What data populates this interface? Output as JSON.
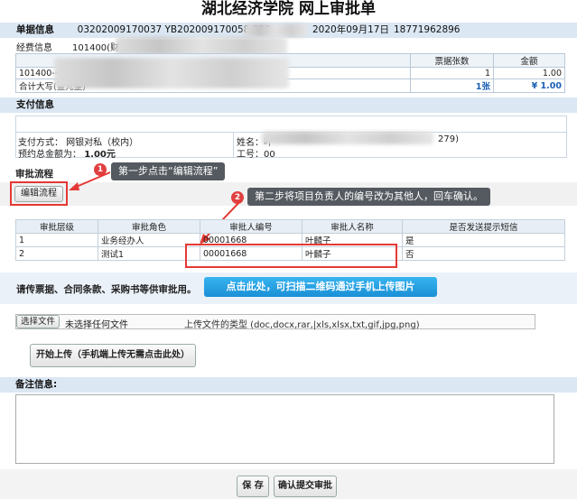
{
  "title": "湖北经济学院 网上审批单",
  "document_info": {
    "section_label": "单据信息",
    "codes": "03202009170037    YB202009170058    000",
    "date": "2020年09月17日",
    "phone": "18771962896",
    "funding_label": "经费信息",
    "funding_value": "101400(财务"
  },
  "expense_table": {
    "headers": [
      "票据张数",
      "金额"
    ],
    "rows": [
      {
        "item": "101400--11",
        "count": "1",
        "amount": "1.00"
      },
      {
        "item": "合计大写(壹元整)",
        "count": "1张",
        "amount": "¥ 1.00"
      }
    ]
  },
  "payment": {
    "section_label": "支付信息",
    "method": "支付方式： 网银对私（校内）",
    "total": "预约总金额为：",
    "total_value": "1.00元",
    "name": "姓名：叶",
    "name_tail": "279)",
    "staff_id": "工号：00"
  },
  "approval": {
    "section_label": "审批流程",
    "edit_button": "编辑流程",
    "callout1": "第一步点击“编辑流程”",
    "callout2": "第二步将项目负责人的编号改为其他人，回车确认。",
    "badge1": "1",
    "badge2": "2",
    "headers": [
      "审批层级",
      "审批角色",
      "审批人编号",
      "审批人名称",
      "是否发送提示短信"
    ],
    "rows": [
      {
        "level": "1",
        "role": "业务经办人",
        "id": "00001668",
        "name": "叶麟子",
        "sms": "是"
      },
      {
        "level": "2",
        "role": "测试1",
        "id": "00001668",
        "name": "叶麟子",
        "sms": "否"
      }
    ]
  },
  "upload": {
    "prompt": "请传票据、合同条款、采购书等供审批用。",
    "qr_button": "点击此处，可扫描二维码通过手机上传图片",
    "choose_file": "选择文件",
    "no_file": "未选择任何文件",
    "types_hint": "上传文件的类型 (doc,docx,rar,|xls,xlsx,txt,gif,jpg,png)",
    "start_upload": "开始上传（手机端上传无需点击此处）"
  },
  "remarks": {
    "label": "备注信息:",
    "value": ""
  },
  "footer": {
    "save": "保 存",
    "submit": "确认提交审批"
  },
  "colors": {
    "section_bg": "#dbe7f3",
    "highlight_red": "#e53935",
    "callout_bg": "#555a60",
    "qr_button_blue": "#1a8fd6",
    "total_blue": "#1a5fb4"
  }
}
